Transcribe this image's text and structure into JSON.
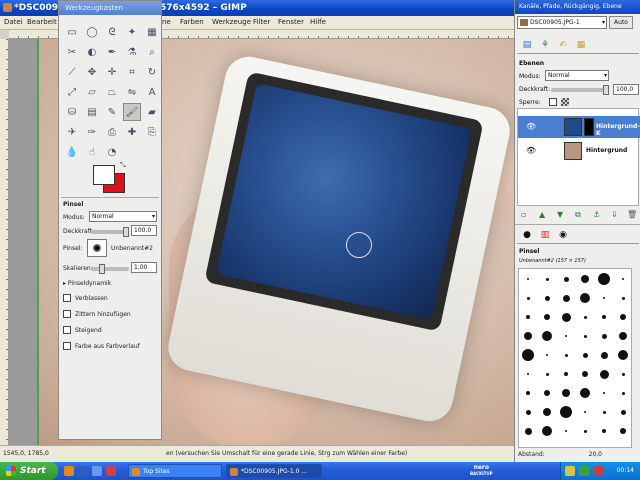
{
  "main_window": {
    "title_left": "*DSC00905",
    "title_right": "576x4592 – GIMP",
    "menu": [
      "Datei",
      "Bearbeit",
      "ne",
      "Farben",
      "Werkzeuge",
      "Filter",
      "Fenster",
      "Hilfe"
    ],
    "status_coords": "1545,0, 1785,0",
    "status_message": "en (versuchen Sie Umschalt für eine gerade Linie, Strg zum Wählen einer Farbe)"
  },
  "toolbox": {
    "title": "Werkzeugkasten",
    "tools": [
      "rect-select",
      "ellipse-select",
      "lasso",
      "fuzzy-select",
      "by-color",
      "scissors",
      "foreground-select",
      "paths",
      "color-picker",
      "zoom",
      "measure",
      "move",
      "align",
      "crop",
      "rotate",
      "scale",
      "shear",
      "perspective",
      "flip",
      "text",
      "bucket-fill",
      "blend",
      "pencil",
      "paintbrush",
      "eraser",
      "airbrush",
      "ink",
      "clone",
      "heal",
      "perspective-clone",
      "convolve",
      "smudge",
      "dodge",
      "burn"
    ],
    "options_title": "Pinsel",
    "modus_label": "Modus:",
    "modus_value": "Normal",
    "deckkraft_label": "Deckkraft:",
    "deckkraft_value": "100,0",
    "deckkraft_level": 1.0,
    "pinsel_label": "Pinsel:",
    "pinsel_value": "Unbenannt#2",
    "skalieren_label": "Skalieren:",
    "skalieren_value": "1,00",
    "skalieren_level": 0.25,
    "pinseldynamik": "Pinseldynamik",
    "checks": [
      "Verblassen",
      "Zittern hinzufügen",
      "Steigend",
      "Farbe aus Farbverlauf"
    ]
  },
  "dock": {
    "title": "Kanäle, Pfade, Rückgängig, Ebene",
    "image_combo": "DSC00905.JPG-1",
    "auto_label": "Auto",
    "layers_title": "Ebenen",
    "modus_label": "Modus:",
    "modus_value": "Normal",
    "deckkraft_label": "Deckkraft:",
    "deckkraft_value": "100,0",
    "sperre_label": "Sperre:",
    "layers": [
      {
        "name": "Hintergrund-K",
        "selected": true
      },
      {
        "name": "Hintergrund",
        "selected": false
      }
    ],
    "brushes_title": "Pinsel",
    "brush_name": "Unbenannt#2 (157 × 157)",
    "abstand_label": "Abstand:",
    "abstand_value": "20,0"
  },
  "taskbar": {
    "start_label": "Start",
    "tasks": [
      {
        "label": "Top Sites",
        "active": false
      },
      {
        "label": "*DSC00905.JPG-1.0 ...",
        "active": true
      }
    ],
    "nero_line1": "nero",
    "nero_line2": "BACKITUP",
    "clock": "00:14"
  },
  "colors": {
    "xp_blue": "#0a46c4",
    "foreground": "#ffffff",
    "background": "#e0101a",
    "selected_layer": "#4a7ed0",
    "guide_green": "#3fa94a"
  }
}
